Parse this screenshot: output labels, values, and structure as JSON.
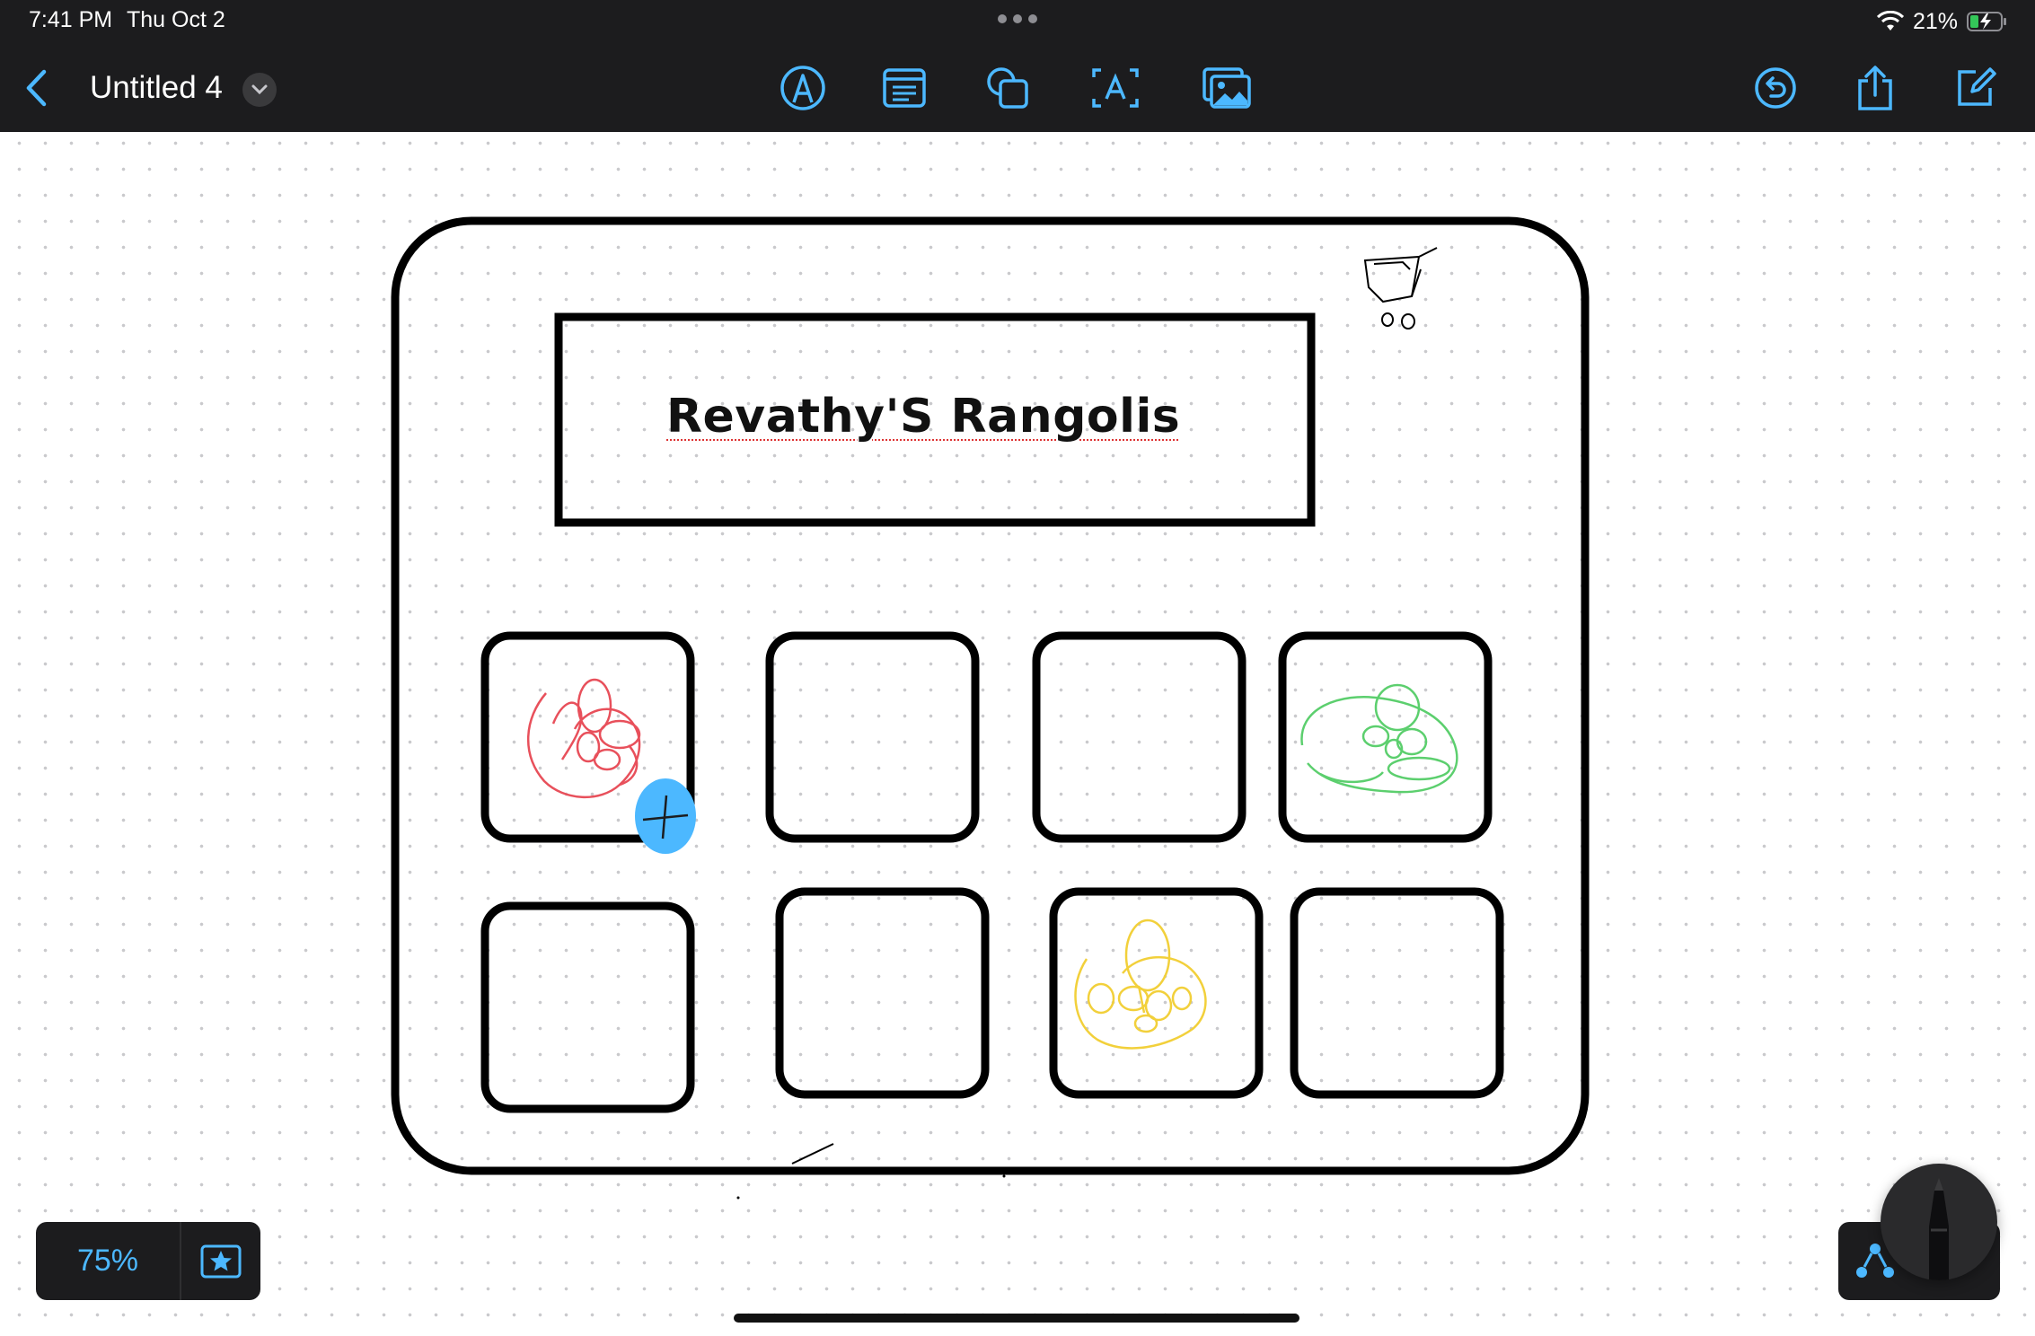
{
  "status_bar": {
    "time": "7:41 PM",
    "date": "Thu Oct 2",
    "battery": "21%"
  },
  "toolbar": {
    "title": "Untitled 4",
    "tools": [
      "pen-tool",
      "text-box",
      "shapes",
      "text",
      "media"
    ],
    "accent_color": "#4cb8ff"
  },
  "board": {
    "title": "Revathy'S Rangolis",
    "tiles_per_row": 4,
    "rows": 2,
    "doodle_colors": {
      "red": "#e8505b",
      "green": "#5ccf6e",
      "yellow": "#f2d03b"
    }
  },
  "bottom": {
    "zoom": "75%"
  },
  "colors": {
    "toolbar_bg": "#1c1c1e",
    "accent": "#4cb8ff",
    "ink": "#000000"
  }
}
